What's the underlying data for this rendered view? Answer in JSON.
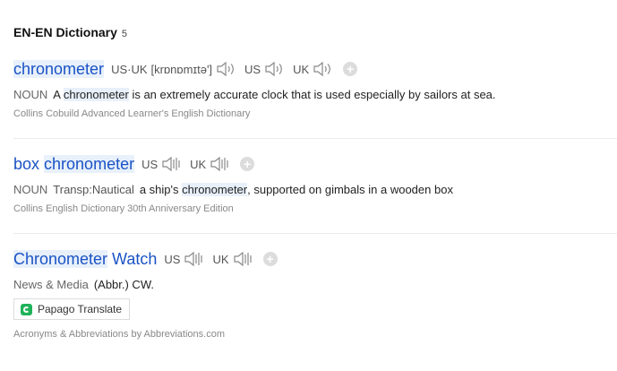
{
  "header": {
    "title": "EN-EN Dictionary",
    "count": "5"
  },
  "entries": [
    {
      "word_parts": [
        "chronometer"
      ],
      "pron": {
        "us_uk_label": "US·UK",
        "phonetic": "[krɒnɒmɪtə']",
        "us_label": "US",
        "uk_label": "UK"
      },
      "pos": "NOUN",
      "def_pre": "A ",
      "def_hl": "chronometer",
      "def_post": " is an extremely accurate clock that is used especially by sailors at sea.",
      "source": "Collins Cobuild Advanced Learner's English Dictionary"
    },
    {
      "word_plain": "box ",
      "word_hl": "chronometer",
      "pron": {
        "us_label": "US",
        "uk_label": "UK"
      },
      "pos": "NOUN",
      "domain": "Transp:Nautical",
      "def_pre": "a ship's ",
      "def_hl": "chronometer",
      "def_post": ", supported on gimbals in a wooden box",
      "source": "Collins English Dictionary 30th Anniversary Edition"
    },
    {
      "word_hl": "Chronometer",
      "word_plain": " Watch",
      "pron": {
        "us_label": "US",
        "uk_label": "UK"
      },
      "category": "News & Media",
      "abbr": "(Abbr.) CW.",
      "papago_label": "Papago Translate",
      "source": "Acronyms & Abbreviations by Abbreviations.com"
    }
  ],
  "colors": {
    "headword": "#1a53c5",
    "highlight": "#e8f0fb",
    "papago_icon": "#1fb25a"
  },
  "icons": [
    "speaker-icon",
    "add-icon",
    "papago-icon"
  ]
}
